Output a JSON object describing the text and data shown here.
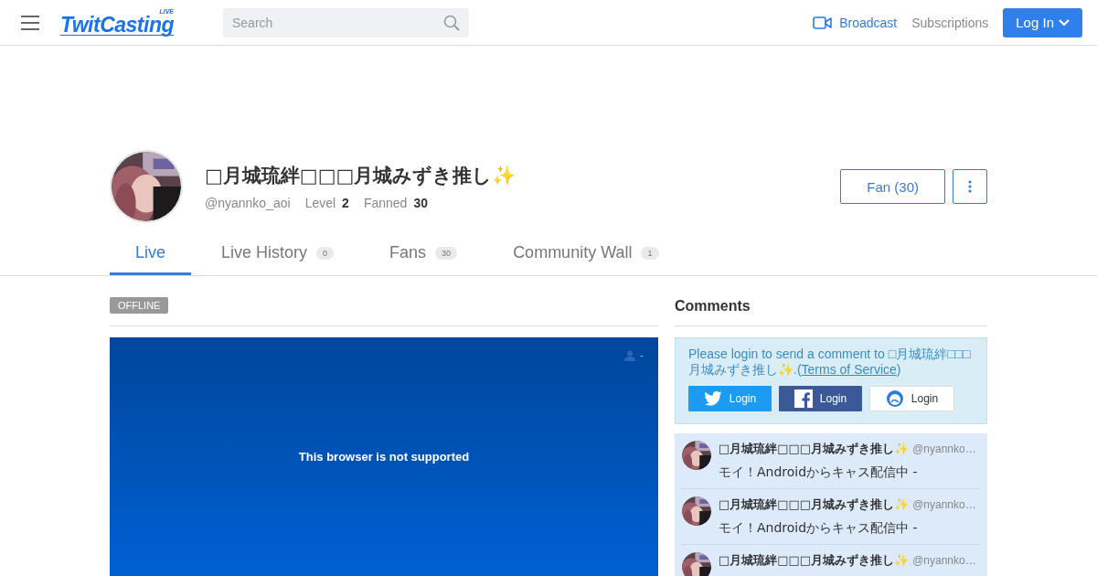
{
  "header": {
    "logo": "TwitCasting",
    "logo_badge": "LIVE",
    "search": {
      "placeholder": "Search"
    },
    "broadcast": "Broadcast",
    "subscriptions": "Subscriptions",
    "login": "Log In"
  },
  "profile": {
    "name": "□月城琉絆□□□月城みずき推し✨",
    "handle": "@nyannko_aoi",
    "level_label": "Level",
    "level": "2",
    "fanned_label": "Fanned",
    "fanned": "30",
    "fan_button": "Fan (30)"
  },
  "tabs": [
    {
      "label": "Live",
      "selected": true
    },
    {
      "label": "Live History",
      "count": "0",
      "selected": false
    },
    {
      "label": "Fans",
      "count": "30",
      "selected": false
    },
    {
      "label": "Community Wall",
      "count": "1",
      "selected": false
    }
  ],
  "live": {
    "status": "OFFLINE",
    "viewers": "-",
    "message": "This browser is not supported"
  },
  "comments": {
    "title": "Comments",
    "notice": "Please login to send a comment to □月城琉絆□□□月城みずき推し✨.(",
    "terms": "Terms of Service",
    "notice_end": ")",
    "logins": [
      {
        "kind": "twitter",
        "label": "Login"
      },
      {
        "kind": "facebook",
        "label": "Login"
      },
      {
        "kind": "twitcasting",
        "label": "Login"
      }
    ],
    "items": [
      {
        "name": "□月城琉絆□□□月城みずき推し✨",
        "handle": "@nyannko…",
        "text": "モイ！Androidからキャス配信中 -"
      },
      {
        "name": "□月城琉絆□□□月城みずき推し✨",
        "handle": "@nyannko…",
        "text": "モイ！Androidからキャス配信中 -"
      },
      {
        "name": "□月城琉絆□□□月城みずき推し✨",
        "handle": "@nyannko…"
      }
    ]
  }
}
